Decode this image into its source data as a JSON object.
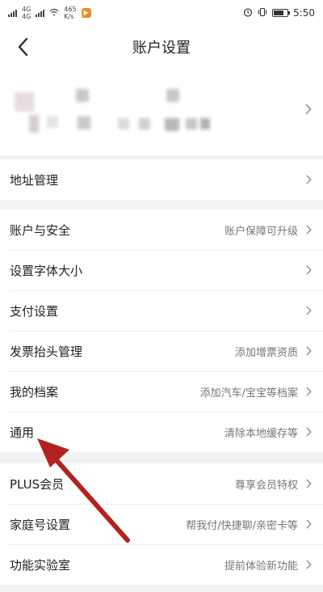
{
  "status": {
    "speed": "465",
    "speed_unit": "K/s",
    "time": "5:50",
    "net_a": "4G",
    "net_b": "4G"
  },
  "nav": {
    "title": "账户设置"
  },
  "groups": [
    {
      "items": [
        {
          "label": "地址管理",
          "value": ""
        }
      ]
    },
    {
      "items": [
        {
          "label": "账户与安全",
          "value": "账户保障可升级"
        },
        {
          "label": "设置字体大小",
          "value": ""
        },
        {
          "label": "支付设置",
          "value": ""
        },
        {
          "label": "发票抬头管理",
          "value": "添加增票资质"
        },
        {
          "label": "我的档案",
          "value": "添加汽车/宝宝等档案"
        },
        {
          "label": "通用",
          "value": "清除本地缓存等"
        }
      ]
    },
    {
      "items": [
        {
          "label": "PLUS会员",
          "value": "尊享会员特权"
        },
        {
          "label": "家庭号设置",
          "value": "帮我付/快捷聊/亲密卡等"
        },
        {
          "label": "功能实验室",
          "value": "提前体验新功能"
        }
      ]
    }
  ],
  "colors": {
    "annotation_arrow": "#b3221f",
    "background": "#f2f2f2"
  }
}
